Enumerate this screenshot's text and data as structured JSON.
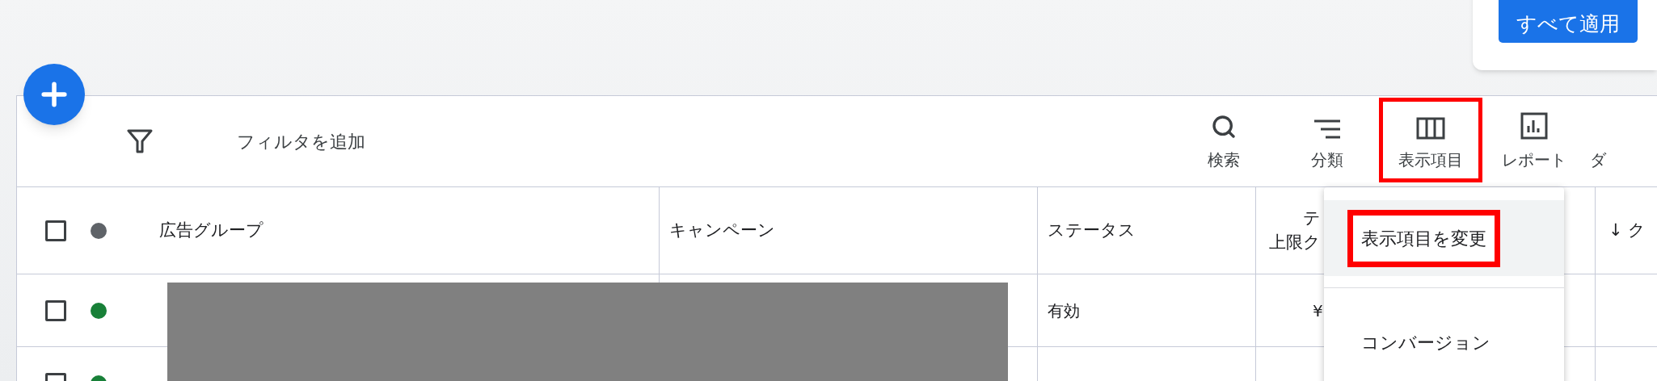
{
  "apply_panel": {
    "button": "すべて適用"
  },
  "toolbar": {
    "filter": "フィルタを追加",
    "buttons": [
      {
        "label": "検索",
        "kind": "search",
        "highlighted": false
      },
      {
        "label": "分類",
        "kind": "segment",
        "highlighted": false
      },
      {
        "label": "表示項目",
        "kind": "columns",
        "highlighted": true
      },
      {
        "label": "レポート",
        "kind": "report",
        "highlighted": false
      },
      {
        "label": "ダ",
        "kind": "cut",
        "highlighted": false
      }
    ]
  },
  "table": {
    "header": {
      "checked": false,
      "color": "#5f6368"
    },
    "columns": [
      {
        "lines": [
          "広告グループ"
        ]
      },
      {
        "lines": [
          "キャンペーン"
        ]
      },
      {
        "lines": [
          "ステータス"
        ]
      },
      {
        "lines": [
          "テ",
          "上限ク"
        ]
      },
      {},
      {
        "lines": [
          "↓ ク"
        ]
      }
    ],
    "rows": [
      {
        "checked": false,
        "color": "#188038",
        "status": "有効",
        "column_4": "¥"
      },
      {
        "checked": false,
        "color": "#188038"
      }
    ]
  },
  "menu": {
    "items": [
      {
        "label": "表示項目を変更",
        "selected": true,
        "highlighted": true
      },
      {
        "label": "コンバージョン",
        "selected": false,
        "highlighted": false
      }
    ]
  }
}
